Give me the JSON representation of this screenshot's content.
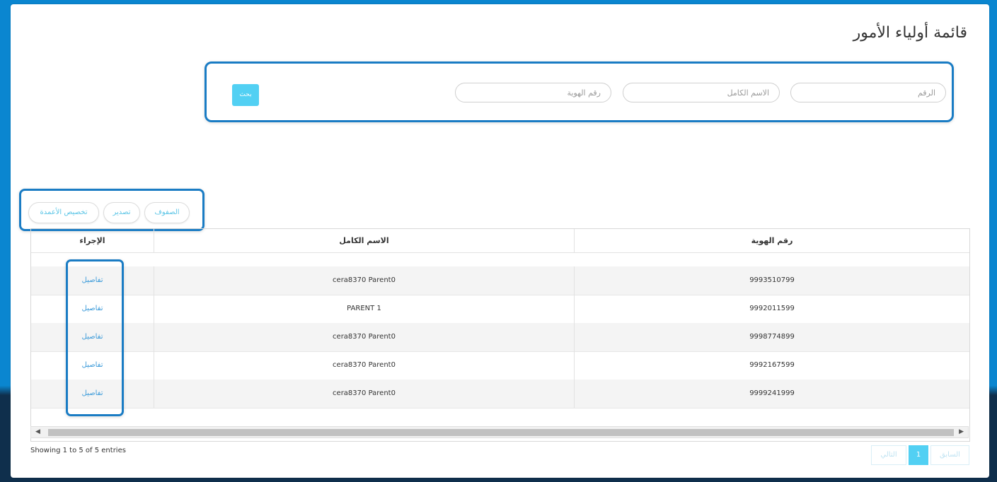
{
  "page": {
    "title": "قائمة أولياء الأمور"
  },
  "filters": {
    "number_placeholder": "الرقم",
    "fullname_placeholder": "الاسم الكامل",
    "idnumber_placeholder": "رقم الهوية",
    "search_label": "بحث"
  },
  "toolbar": {
    "rows_label": "الصفوف",
    "export_label": "تصدير",
    "columns_label": "تخصيص الأعمدة"
  },
  "table": {
    "headers": {
      "id_number": "رقم الهوية",
      "full_name": "الاسم الكامل",
      "action": "الإجراء"
    },
    "rows": [
      {
        "id_number": "9993510799",
        "full_name": "cera8370 Parent0",
        "action": "تفاصيل"
      },
      {
        "id_number": "9992011599",
        "full_name": "PARENT 1",
        "action": "تفاصيل"
      },
      {
        "id_number": "9998774899",
        "full_name": "cera8370 Parent0",
        "action": "تفاصيل"
      },
      {
        "id_number": "9992167599",
        "full_name": "cera8370 Parent0",
        "action": "تفاصيل"
      },
      {
        "id_number": "9999241999",
        "full_name": "cera8370 Parent0",
        "action": "تفاصيل"
      }
    ]
  },
  "footer": {
    "info": "Showing 1 to 5 of 5 entries",
    "prev_label": "السابق",
    "current_page": "1",
    "next_label": "التالي"
  },
  "colors": {
    "accent": "#52d0f3",
    "highlight_border": "#1a7cc4",
    "link": "#3a9ad9"
  }
}
